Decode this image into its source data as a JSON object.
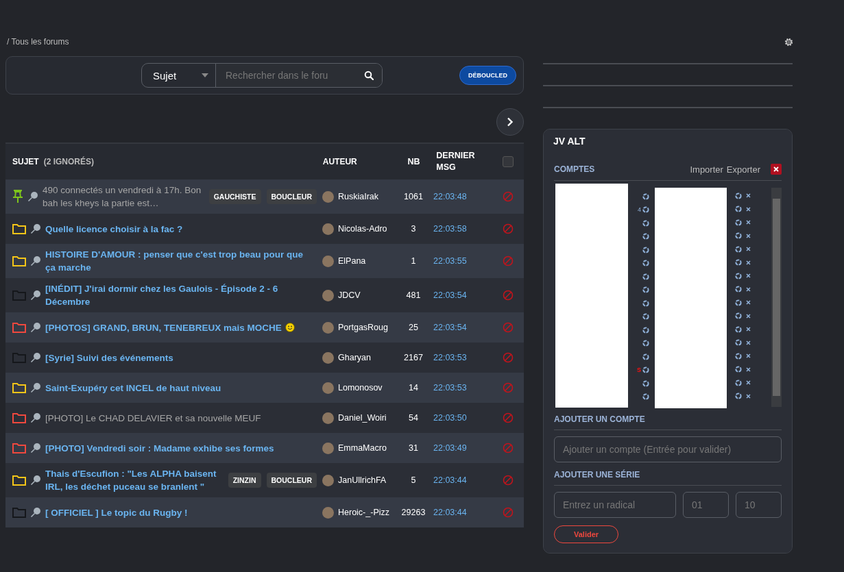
{
  "breadcrumb": "/ Tous les forums",
  "search": {
    "scope": "Sujet",
    "placeholder": "Rechercher dans le foru"
  },
  "badge": "DÉBOUCLED",
  "table": {
    "columns": {
      "subject": "SUJET",
      "ignored": "(2 IGNORÉS)",
      "author": "AUTEUR",
      "count": "NB",
      "last": "DERNIER MSG"
    },
    "select_all": {
      "checked": false
    },
    "rows": [
      {
        "kind": "pinned",
        "title": "490 connectés un vendredi à 17h. Bon bah les kheys la partie est…",
        "visited": true,
        "tags": [
          "GAUCHISTE",
          "BOUCLEUR"
        ],
        "author": "RuskiaIrak",
        "count": "1061",
        "last": "22:03:48"
      },
      {
        "kind": "hot",
        "title": "Quelle licence choisir à la fac ?",
        "visited": false,
        "tags": [],
        "author": "Nicolas-Adro",
        "count": "3",
        "last": "22:03:58"
      },
      {
        "kind": "hot",
        "title": "HISTOIRE D'AMOUR : penser que c'est trop beau pour que ça marche",
        "visited": false,
        "tags": [],
        "author": "ElPana",
        "count": "1",
        "last": "22:03:55"
      },
      {
        "kind": "normal",
        "title": "[INÉDIT] J'irai dormir chez les Gaulois - Épisode 2 - 6 Décembre",
        "visited": false,
        "tags": [],
        "author": "JDCV",
        "count": "481",
        "last": "22:03:54"
      },
      {
        "kind": "very_hot",
        "title": "[PHOTOS] GRAND, BRUN, TENEBREUX mais MOCHE",
        "visited": false,
        "smiley": true,
        "tags": [],
        "author": "PortgasRoug",
        "count": "25",
        "last": "22:03:54"
      },
      {
        "kind": "normal",
        "title": "[Syrie] Suivi des événements",
        "visited": false,
        "tags": [],
        "author": "Gharyan",
        "count": "2167",
        "last": "22:03:53"
      },
      {
        "kind": "hot",
        "title": "Saint-Exupéry cet INCEL de haut niveau",
        "visited": false,
        "tags": [],
        "author": "Lomonosov",
        "count": "14",
        "last": "22:03:53"
      },
      {
        "kind": "very_hot",
        "title": "[PHOTO] Le CHAD DELAVIER et sa nouvelle MEUF",
        "visited": true,
        "tags": [],
        "author": "Daniel_Woiri",
        "count": "54",
        "last": "22:03:50"
      },
      {
        "kind": "very_hot",
        "title": "[PHOTO] Vendredi soir : Madame exhibe ses formes",
        "visited": false,
        "tags": [],
        "author": "EmmaMacro",
        "count": "31",
        "last": "22:03:49"
      },
      {
        "kind": "hot",
        "title": "Thais d'Escufion : \"Les ALPHA baisent IRL, les déchet puceau se branlent \"",
        "visited": false,
        "tags": [
          "ZINZIN",
          "BOUCLEUR"
        ],
        "author": "JanUllrichFA",
        "count": "5",
        "last": "22:03:44"
      },
      {
        "kind": "normal",
        "title": "[ OFFICIEL ] Le topic du Rugby !",
        "visited": false,
        "tags": [],
        "author": "Heroic-_-Pizz",
        "count": "29263",
        "last": "22:03:44"
      }
    ]
  },
  "panel": {
    "title": "JV ALT",
    "accounts_label": "COMPTES",
    "import": "Importer",
    "export": "Exporter",
    "accounts": [
      {
        "kind": "plain"
      },
      {
        "kind": "fragment",
        "tail": "4",
        "tail_alert": false
      },
      {
        "kind": "plain"
      },
      {
        "kind": "plain"
      },
      {
        "kind": "plain"
      },
      {
        "kind": "plain"
      },
      {
        "kind": "plain"
      },
      {
        "kind": "plain"
      },
      {
        "kind": "plain"
      },
      {
        "kind": "plain"
      },
      {
        "kind": "plain"
      },
      {
        "kind": "plain"
      },
      {
        "kind": "plain"
      },
      {
        "kind": "fragment",
        "tail": "S",
        "tail_alert": true
      },
      {
        "kind": "plain"
      },
      {
        "kind": "plain"
      }
    ],
    "add_account": {
      "label": "AJOUTER UN COMPTE",
      "placeholder": "Ajouter un compte (Entrée pour valider)"
    },
    "add_series": {
      "label": "AJOUTER UNE SÉRIE",
      "radical_placeholder": "Entrez un radical",
      "from_placeholder": "01",
      "to_placeholder": "10",
      "submit": "Valider"
    }
  }
}
